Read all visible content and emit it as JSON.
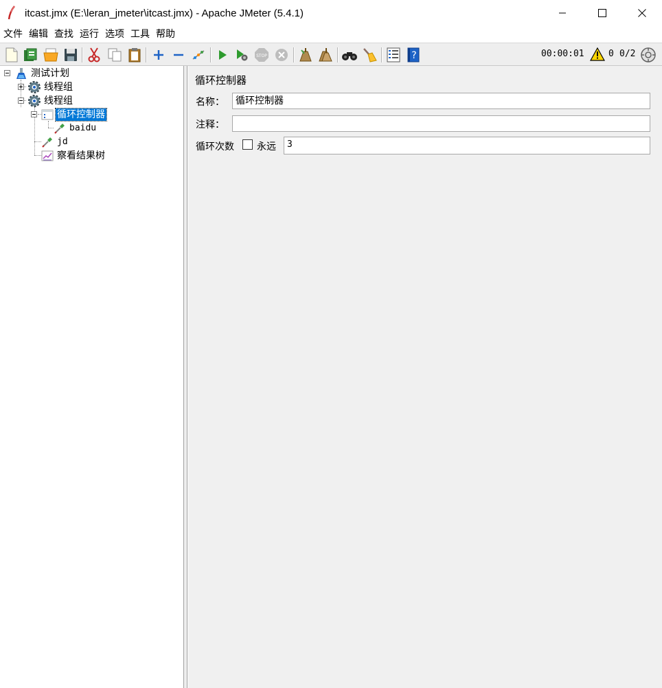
{
  "window": {
    "title": "itcast.jmx (E:\\leran_jmeter\\itcast.jmx) - Apache JMeter (5.4.1)"
  },
  "menu": {
    "items": [
      "文件",
      "编辑",
      "查找",
      "运行",
      "选项",
      "工具",
      "帮助"
    ]
  },
  "toolbar": {
    "icons": [
      "new-icon",
      "templates-icon",
      "open-icon",
      "save-icon",
      "cut-icon",
      "copy-icon",
      "paste-icon",
      "expand-icon",
      "collapse-icon",
      "toggle-icon",
      "start-icon",
      "start-no-pause-icon",
      "stop-icon",
      "shutdown-icon",
      "clear-icon",
      "clear-all-icon",
      "search-icon",
      "reset-search-icon",
      "function-helper-icon",
      "help-icon"
    ],
    "status": {
      "elapsed_time": "00:00:01",
      "warning_count": "0",
      "threads": "0/2"
    }
  },
  "tree": {
    "nodes": [
      {
        "label": "测试计划",
        "icon": "test-plan-icon",
        "expanded": true
      },
      {
        "label": "线程组",
        "icon": "thread-group-icon",
        "expanded": false
      },
      {
        "label": "线程组",
        "icon": "thread-group-icon",
        "expanded": true
      },
      {
        "label": "循环控制器",
        "icon": "loop-controller-icon",
        "expanded": true,
        "selected": true
      },
      {
        "label": "baidu",
        "icon": "sampler-icon"
      },
      {
        "label": "jd",
        "icon": "sampler-icon"
      },
      {
        "label": "察看结果树",
        "icon": "results-tree-icon"
      }
    ]
  },
  "editor": {
    "panel_title": "循环控制器",
    "name_label": "名称：",
    "name_value": "循环控制器",
    "comment_label": "注释：",
    "comment_value": "",
    "loop_count_label": "循环次数",
    "forever_label": "永远",
    "forever_checked": false,
    "loop_count_value": "3"
  }
}
